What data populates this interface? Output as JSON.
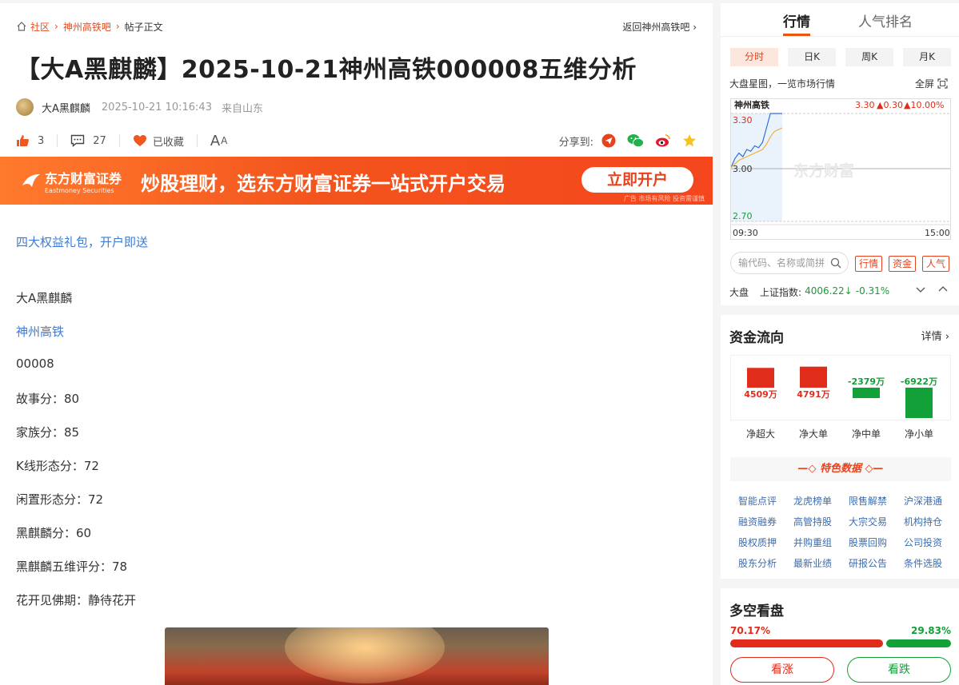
{
  "breadcrumb": {
    "home": "社区",
    "bar": "神州高铁吧",
    "current": "帖子正文",
    "back": "返回神州高铁吧"
  },
  "post": {
    "title": "【大A黑麒麟】2025-10-21神州高铁000008五维分析",
    "author": "大A黑麒麟",
    "time": "2025-10-21 10:16:43",
    "location": "来自山东",
    "likes": "3",
    "comments": "27",
    "favorite": "已收藏",
    "font_toggle_big": "A",
    "font_toggle_small": "A",
    "share_label": "分享到:"
  },
  "banner": {
    "logo": "东方财富证券",
    "logo_en": "Eastmoney Securities",
    "slogan": "炒股理财，选东方财富证券一站式开户交易",
    "button": "立即开户",
    "ad_note": "广告 市场有风险 投资需谨慎"
  },
  "content": {
    "promo_link": "四大权益礼包，开户即送",
    "lines": [
      "大A黑麒麟",
      "神州高铁",
      "00008",
      "故事分：80",
      "家族分：85",
      "K线形态分：72",
      "闲置形态分：72",
      "黑麒麟分：60",
      "黑麒麟五维评分：78",
      "花开见佛期：静待花开"
    ]
  },
  "market": {
    "tabs": [
      "行情",
      "人气排名"
    ],
    "periods": [
      "分时",
      "日K",
      "周K",
      "月K"
    ],
    "map_label": "大盘星图，一览市场行情",
    "fullscreen": "全屏",
    "stock_name": "神州高铁",
    "price": "3.30",
    "change": "▲0.30",
    "change_pct": "▲10.00%",
    "y_high": "3.30",
    "y_mid": "3.00",
    "y_low": "2.70",
    "t_start": "09:30",
    "t_end": "15:00",
    "watermark": "东方财富",
    "search_placeholder": "输代码、名称或简拼",
    "tags": [
      "行情",
      "资金",
      "人气"
    ],
    "index_label": "大盘",
    "index_name": "上证指数:",
    "index_value": "4006.22↓",
    "index_pct": "-0.31%"
  },
  "chart_data": {
    "type": "line",
    "title": "神州高铁",
    "x": [
      "09:30",
      "09:33",
      "09:36",
      "09:39",
      "09:42",
      "09:45",
      "09:48",
      "09:51",
      "09:54",
      "09:57",
      "10:00",
      "10:05",
      "10:10",
      "10:16"
    ],
    "series": [
      {
        "values": [
          3.0,
          3.05,
          3.08,
          3.06,
          3.1,
          3.09,
          3.12,
          3.11,
          3.14,
          3.22,
          3.3,
          3.3,
          3.3,
          3.3
        ]
      },
      {
        "values": [
          3.0,
          3.02,
          3.04,
          3.05,
          3.06,
          3.07,
          3.08,
          3.09,
          3.1,
          3.13,
          3.17,
          3.2,
          3.21,
          3.22
        ]
      }
    ],
    "ylim": [
      2.7,
      3.3
    ],
    "ticks_y": [
      "3.30",
      "3.00",
      "2.70"
    ],
    "ticks_x": [
      "09:30",
      "15:00"
    ]
  },
  "fund_flow": {
    "title": "资金流向",
    "more": "详情",
    "items": [
      {
        "label": "净超大",
        "value": "4509万",
        "amount": 4509
      },
      {
        "label": "净大单",
        "value": "4791万",
        "amount": 4791
      },
      {
        "label": "净中单",
        "value": "-2379万",
        "amount": -2379
      },
      {
        "label": "净小单",
        "value": "-6922万",
        "amount": -6922
      }
    ],
    "colors": {
      "up": "#e02c1a",
      "down": "#12a038"
    }
  },
  "features": {
    "title": "特色数据",
    "items": [
      "智能点评",
      "龙虎榜单",
      "限售解禁",
      "沪深港通",
      "融资融券",
      "高管持股",
      "大宗交易",
      "机构持仓",
      "股权质押",
      "并购重组",
      "股票回购",
      "公司投资",
      "股东分析",
      "最新业绩",
      "研报公告",
      "条件选股"
    ]
  },
  "sentiment": {
    "title": "多空看盘",
    "bull_pct": "70.17%",
    "bear_pct": "29.83%",
    "bull_ratio": 0.7017,
    "bull_btn": "看涨",
    "bear_btn": "看跌"
  }
}
